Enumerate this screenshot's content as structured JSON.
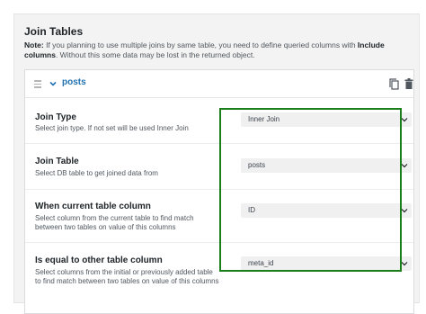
{
  "section": {
    "title": "Join Tables",
    "note_label": "Note:",
    "note_text_1": " If you planning to use multiple joins by same table, you need to define queried columns with ",
    "note_emphasis": "Include columns",
    "note_text_2": ". Without this some data may be lost in the returned object."
  },
  "join": {
    "name": "posts",
    "rows": [
      {
        "label": "Join Type",
        "description": "Select join type. If not set will be used Inner Join",
        "value": "Inner Join"
      },
      {
        "label": "Join Table",
        "description": "Select DB table to get joined data from",
        "value": "posts"
      },
      {
        "label": "When current table column",
        "description": "Select column from the current table to find match between two tables on value of this columns",
        "value": "ID"
      },
      {
        "label": "Is equal to other table column",
        "description": "Select columns from the initial or previously added table to find match between two tables on value of this columns",
        "value": "meta_id"
      }
    ]
  },
  "colors": {
    "accent": "#2271b1",
    "highlight_border": "#1a7f1a"
  },
  "icons": [
    "drag-handle-icon",
    "chevron-down-icon",
    "copy-icon",
    "trash-icon",
    "caret-down-icon"
  ]
}
